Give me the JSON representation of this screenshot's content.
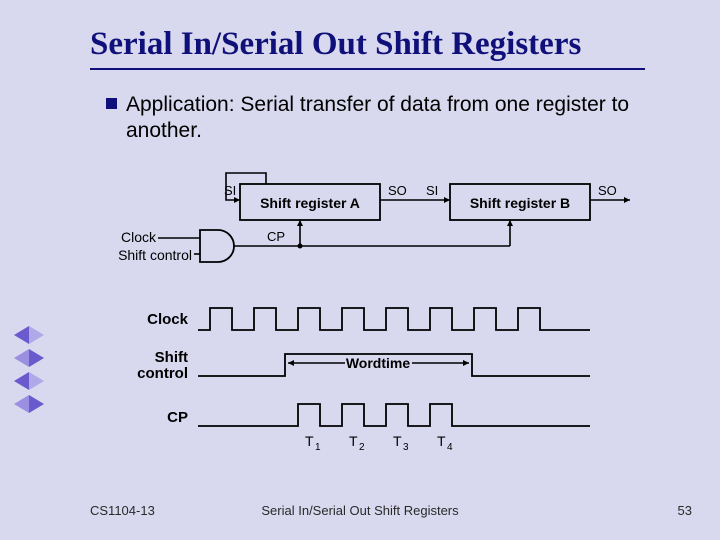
{
  "title": "Serial In/Serial Out Shift Registers",
  "bullet": "Application: Serial transfer of data from one register to another.",
  "diagram": {
    "regA": "Shift register A",
    "regB": "Shift register B",
    "si": "SI",
    "so": "SO",
    "clock": "Clock",
    "shift_control": "Shift control",
    "cp": "CP",
    "wordtime": "Wordtime",
    "t1": "T",
    "t1s": "1",
    "t2": "T",
    "t2s": "2",
    "t3": "T",
    "t3s": "3",
    "t4": "T",
    "t4s": "4"
  },
  "footer": {
    "left": "CS1104-13",
    "center": "Serial In/Serial Out Shift Registers",
    "right": "53"
  }
}
